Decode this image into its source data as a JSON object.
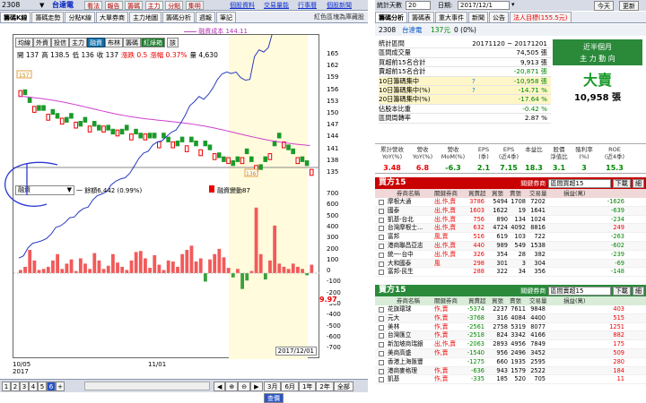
{
  "topbar": {
    "code": "2308",
    "name": "台達電",
    "buttons": [
      "看法",
      "報告",
      "籌碼",
      "主力",
      "分點",
      "集明"
    ],
    "links": [
      "個股資料",
      "交易量能",
      "行事曆",
      "個股新聞"
    ]
  },
  "tabs1": [
    "籌碼K線",
    "籌碼走勢",
    "分點K線",
    "大單券商",
    "主力地圖",
    "籌碼分析",
    "週報",
    "筆記"
  ],
  "tabs1_note": "紅色區塊為庫藏股",
  "toolbar": [
    "均線",
    "外資",
    "投信",
    "主力",
    "融資",
    "布林",
    "籌碼",
    "紅綠箱",
    "該"
  ],
  "toolbar_ranges": "融資成本 144.11",
  "ohlc": {
    "open": "開 137",
    "high": "高 138.5",
    "low": "低 136",
    "close": "收 137",
    "chg": "漲跌 0.5",
    "pct": "漲幅 0.37%",
    "vol": "量 4,630"
  },
  "price_axis": [
    "165",
    "162",
    "159",
    "156",
    "153",
    "150",
    "147",
    "144",
    "141",
    "138",
    "135"
  ],
  "price_tag_high": "157",
  "price_tag_low": "136",
  "indicator": {
    "select": "融資",
    "total": "一 餘額6,442 (0.99%)",
    "legend": "融資變動87"
  },
  "vol_axis": [
    "700",
    "600",
    "500",
    "400",
    "300",
    "200",
    "100",
    "0",
    "-100",
    "-200",
    "-300",
    "-400",
    "-500",
    "-600",
    "-700"
  ],
  "vol_tag": "9.97",
  "xaxis": {
    "d1": "10/05",
    "y1": "2017",
    "d2": "11/01",
    "cur": "2017/12/01"
  },
  "pages": [
    "1",
    "2",
    "3",
    "4",
    "5",
    "6",
    "+"
  ],
  "range_btns": [
    "3月",
    "6月",
    "1年",
    "2年",
    "全部",
    "查價"
  ],
  "right": {
    "period_label": "統計天數",
    "period_val": "20",
    "date_label": "日期:",
    "date_val": "2017/12/1",
    "today": "今天",
    "refresh": "更新",
    "tabs": [
      "籌碼分析",
      "籌碼表",
      "重大事件",
      "新聞",
      "公告",
      "法人目標(155.5元)"
    ],
    "stock_code": "2308",
    "stock_name": "台達電",
    "stock_price": "137元",
    "stock_chg": "0 (0%)",
    "stats": [
      {
        "k": "統計區間",
        "v": "20171120 ~ 20171201"
      },
      {
        "k": "區間成交量",
        "v": "74,505 張"
      },
      {
        "k": "買超前15名合計",
        "v": "9,913 張"
      },
      {
        "k": "賣超前15名合計",
        "v": "-20,871 張"
      },
      {
        "k": "10日籌碼集中",
        "v": "-10,958 張"
      },
      {
        "k": "10日籌碼集中(%)",
        "v": "-14.71 %"
      },
      {
        "k": "20日籌碼集中(%)",
        "v": "-17.64 %"
      },
      {
        "k": "佔股本比重",
        "v": "-0.42 %"
      },
      {
        "k": "區間周轉率",
        "v": "2.87 %"
      }
    ],
    "big_l1": "近半個月",
    "big_l2": "主 力 動 向",
    "big_word": "大賣",
    "big_num": "10,958 張",
    "fin_heads": [
      "累計營收\nYoY(%)",
      "營收\nYoY(%)",
      "營收\nMoM(%)",
      "EPS\n(季)",
      "EPS\n(近4季)",
      "本益比",
      "股價\n淨值比",
      "殖利率\n(%)",
      "ROE\n(近4季)"
    ],
    "fin_vals": [
      "3.48",
      "6.8",
      "-6.3",
      "2.1",
      "7.15",
      "18.3",
      "3.1",
      "3",
      "15.3"
    ],
    "buy": {
      "title": "買方15",
      "sel_label": "關鍵券商",
      "sel_val": "區間買超15",
      "b1": "下載",
      "b2": "細",
      "heads": [
        "券商名稱",
        "關鍵券商",
        "買賣超",
        "買張",
        "賣張",
        "交易量",
        "損益(萬)"
      ],
      "rows": [
        [
          "摩根大通",
          "出,作,賣",
          "3786",
          "5494",
          "1708",
          "7202",
          "-1626"
        ],
        [
          "國泰",
          "出,作,賣",
          "1603",
          "1622",
          "19",
          "1641",
          "-639"
        ],
        [
          "凱基-台北",
          "出,作,賣",
          "756",
          "890",
          "134",
          "1024",
          "-234"
        ],
        [
          "台灣摩根士...",
          "出,作,賣",
          "632",
          "4724",
          "4092",
          "8816",
          "249"
        ],
        [
          "富邦",
          "風,賣",
          "516",
          "619",
          "103",
          "722",
          "-263"
        ],
        [
          "港商聯昌亞志",
          "出,作,賣",
          "440",
          "989",
          "549",
          "1538",
          "-602"
        ],
        [
          "統一-台中",
          "出,作,賣",
          "326",
          "354",
          "28",
          "382",
          "-239"
        ],
        [
          "大和國泰",
          "風",
          "298",
          "301",
          "3",
          "304",
          "-69"
        ],
        [
          "富邦-民生",
          "",
          "288",
          "322",
          "34",
          "356",
          "-148"
        ]
      ]
    },
    "sell": {
      "title": "賣方15",
      "sel_label": "關鍵券商",
      "sel_val": "區間賣超15",
      "b1": "下載",
      "b2": "細",
      "heads": [
        "券商名稱",
        "關鍵券商",
        "買賣超",
        "買張",
        "賣張",
        "交易量",
        "損益(萬)"
      ],
      "rows": [
        [
          "花旗環球",
          "作,賣",
          "-5374",
          "2237",
          "7611",
          "9848",
          "403"
        ],
        [
          "元大",
          "作,賣",
          "-3768",
          "316",
          "4084",
          "4400",
          "515"
        ],
        [
          "美林",
          "作,賣",
          "-2561",
          "2758",
          "5319",
          "8077",
          "1251"
        ],
        [
          "台灣匯立",
          "作,賣",
          "-2518",
          "824",
          "3342",
          "4166",
          "882"
        ],
        [
          "新加坡商瑞銀",
          "出,作,賣",
          "-2063",
          "2893",
          "4956",
          "7849",
          "175"
        ],
        [
          "美商高盛",
          "作,賣",
          "-1540",
          "956",
          "2496",
          "3452",
          "509"
        ],
        [
          "香港上海匯豐",
          "",
          "-1275",
          "660",
          "1935",
          "2595",
          "280"
        ],
        [
          "港商麥格理",
          "作,賣",
          "-636",
          "943",
          "1579",
          "2522",
          "184"
        ],
        [
          "凱基",
          "作,賣",
          "-335",
          "185",
          "520",
          "705",
          "11"
        ]
      ]
    }
  }
}
